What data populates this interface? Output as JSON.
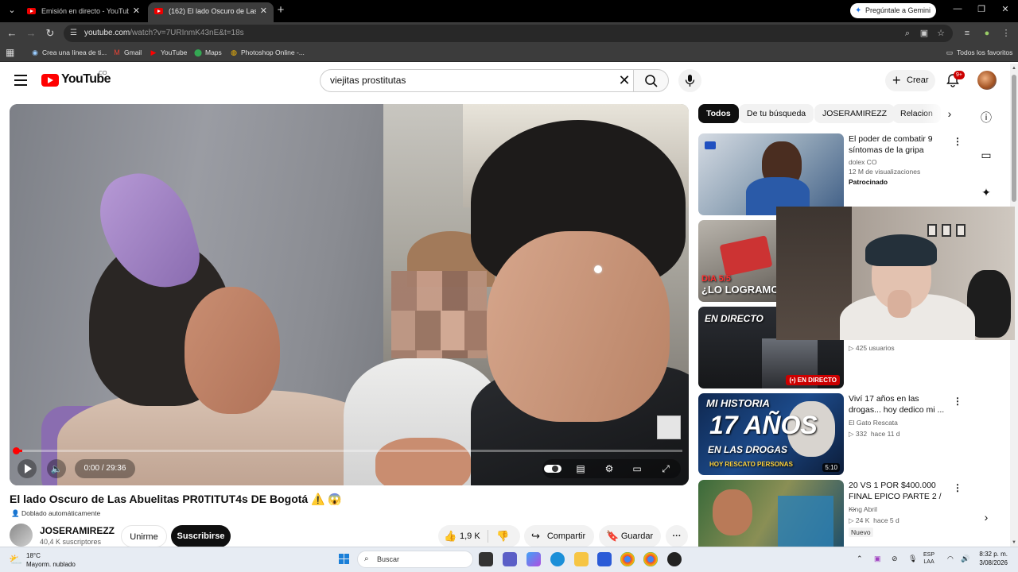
{
  "browser": {
    "tabs": [
      {
        "title": "Emisión en directo - YouTube S",
        "active": false
      },
      {
        "title": "(162) El lado Oscuro de Las Abu",
        "active": true
      }
    ],
    "gemini_button": "Pregúntale a Gemini",
    "url_host": "youtube.com",
    "url_path": "/watch?v=7URInmK43nE&t=18s",
    "bookmarks": [
      "Crea una línea de ti...",
      "Gmail",
      "YouTube",
      "Maps",
      "Photoshop Online -..."
    ],
    "all_bookmarks": "Todos los favoritos"
  },
  "youtube": {
    "logo_text": "YouTube",
    "country": "CO",
    "search_query": "viejitas prostitutas",
    "create_label": "Crear",
    "notif_badge": "9+"
  },
  "player": {
    "time": "0:00 / 29:36",
    "progress_fraction": 0.01
  },
  "video": {
    "title": "El lado Oscuro de Las Abuelitas PR0TITUT4s DE Bogotá ⚠️ 😱",
    "dubbed": "Doblado automáticamente",
    "channel": "JOSERAMIREZZ",
    "subscribers": "40,4 K suscriptores",
    "join_label": "Unirme",
    "subscribe_label": "Suscribirse",
    "likes": "1,9 K",
    "share_label": "Compartir",
    "save_label": "Guardar"
  },
  "chips": [
    "Todos",
    "De tu búsqueda",
    "JOSERAMIREZZ",
    "Relacion"
  ],
  "recommendations": [
    {
      "title": "El poder de combatir 9 síntomas de la gripa",
      "channel": "dolex CO",
      "views": "12 M de visualizaciones",
      "extra": "Patrocinado"
    },
    {
      "title": "",
      "channel": "",
      "views": "",
      "extra": "",
      "thumb_text": "¿LO LOGRAMO",
      "thumb_text2": "DIA 5/5"
    },
    {
      "title": "",
      "channel": "",
      "views": "425 usuarios",
      "extra": "",
      "thumb_text": "EN DIRECTO",
      "badge": "EN DIRECTO"
    },
    {
      "title": "Viví 17 años en las drogas... hoy dedico mi ...",
      "channel": "El Gato Rescata",
      "views": "332",
      "age": "hace 11 d",
      "duration": "5:10",
      "thumb_text": "MI HISTORIA",
      "thumb_big": "17 AÑOS",
      "thumb_sub": "EN LAS DROGAS",
      "thumb_small": "HOY RESCATO PERSONAS"
    },
    {
      "title": "20 VS 1 POR $400.000 FINAL EPICO  PARTE 2 / ...",
      "channel": "King Abril",
      "views": "24 K",
      "age": "hace 5 d",
      "badge": "Nuevo"
    }
  ],
  "taskbar": {
    "temp": "18°C",
    "weather": "Mayorm. nublado",
    "search": "Buscar",
    "lang1": "ESP",
    "lang2": "LAA",
    "time": "8:32 p. m.",
    "date": "3/08/2026"
  },
  "colors": {
    "youtube_red": "#ff0000",
    "live_red": "#cc0000",
    "accent_blue": "#1a73e8"
  }
}
